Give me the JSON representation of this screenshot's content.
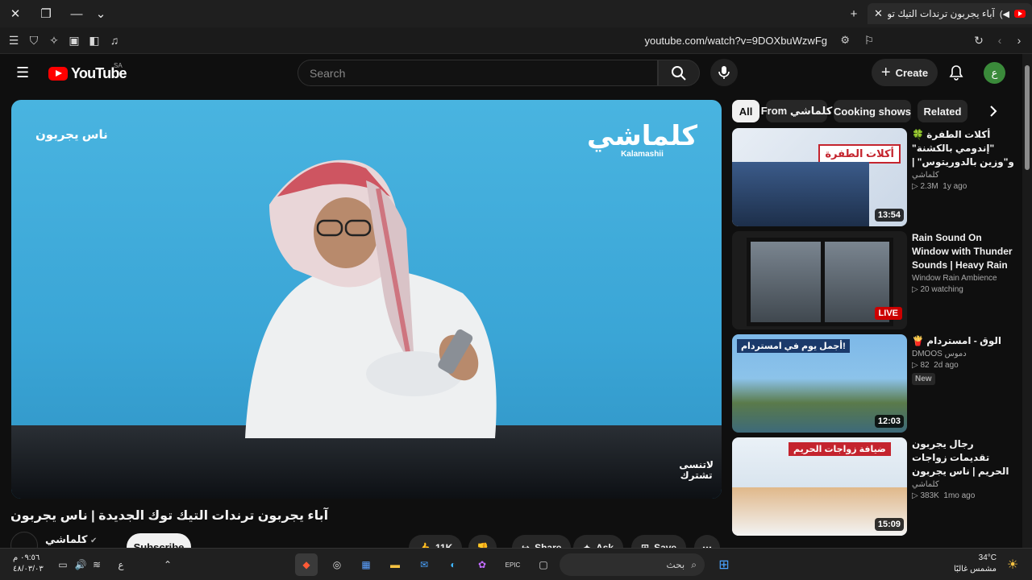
{
  "browser": {
    "tab_title": "آباء يجربون ترندات التيك توك ال",
    "url": "youtube.com/watch?v=9DOXbuWzwFg",
    "shield_count": "63"
  },
  "header": {
    "logo": "YouTube",
    "country": "SA",
    "search_placeholder": "Search",
    "create_label": "Create",
    "avatar_letter": "ع"
  },
  "video": {
    "overlay_channel": "ناس يجربون",
    "brand_ar": "كلماشي",
    "brand_en": "Kalamashii",
    "watermark_line1": "لاتنسى",
    "watermark_line2": "تشترك",
    "title": "آباء يجربون ترندات التيك توك الجديدة | ناس يجربون",
    "channel": "كلماشي",
    "subscribe": "Subscribe",
    "likes": "11K",
    "share": "Share",
    "ask": "Ask",
    "save": "Save"
  },
  "chips": [
    "All",
    "From كلماشي",
    "Cooking shows",
    "Related"
  ],
  "recommendations": [
    {
      "title": "أكلات الطفرة 🍀 \"إندومي بالكشنة\" و\"وزين بالدوريتوس\" | ناس يجربون",
      "channel": "كلماشي",
      "views": "2.3M",
      "age": "1y ago",
      "duration": "13:54",
      "thumb_text": "أكلات الطفرة",
      "rtl": true
    },
    {
      "title": "Rain Sound On Window with Thunder Sounds | Heavy Rain for Sleep, ...",
      "channel": "Window Rain Ambience",
      "views": "20 watching",
      "age": "",
      "live": "LIVE",
      "rtl": false
    },
    {
      "title": "الوق - امستردام 🍟",
      "channel": "DMOOS دموس",
      "views": "82",
      "age": "2d ago",
      "duration": "12:03",
      "badge": "New",
      "thumb_text": "أجمل يوم في امستردام!",
      "rtl": true
    },
    {
      "title": "رجال يجربون تقديمات زواجات الحريم | ناس يجربون",
      "channel": "كلماشي",
      "views": "383K",
      "age": "1mo ago",
      "duration": "15:09",
      "thumb_text": "ضيافة زواجات الحريم",
      "rtl": true
    }
  ],
  "taskbar": {
    "search_label": "بحث",
    "temperature": "34°C",
    "weather": "مشمس غالبًا",
    "time": "٠٩:٥٦ م",
    "date": "٤٨/٠٣/٠٣",
    "lang": "ع"
  },
  "colors": {
    "accent": "#ff0000",
    "background": "#0f0f0f",
    "surface": "#272727"
  }
}
